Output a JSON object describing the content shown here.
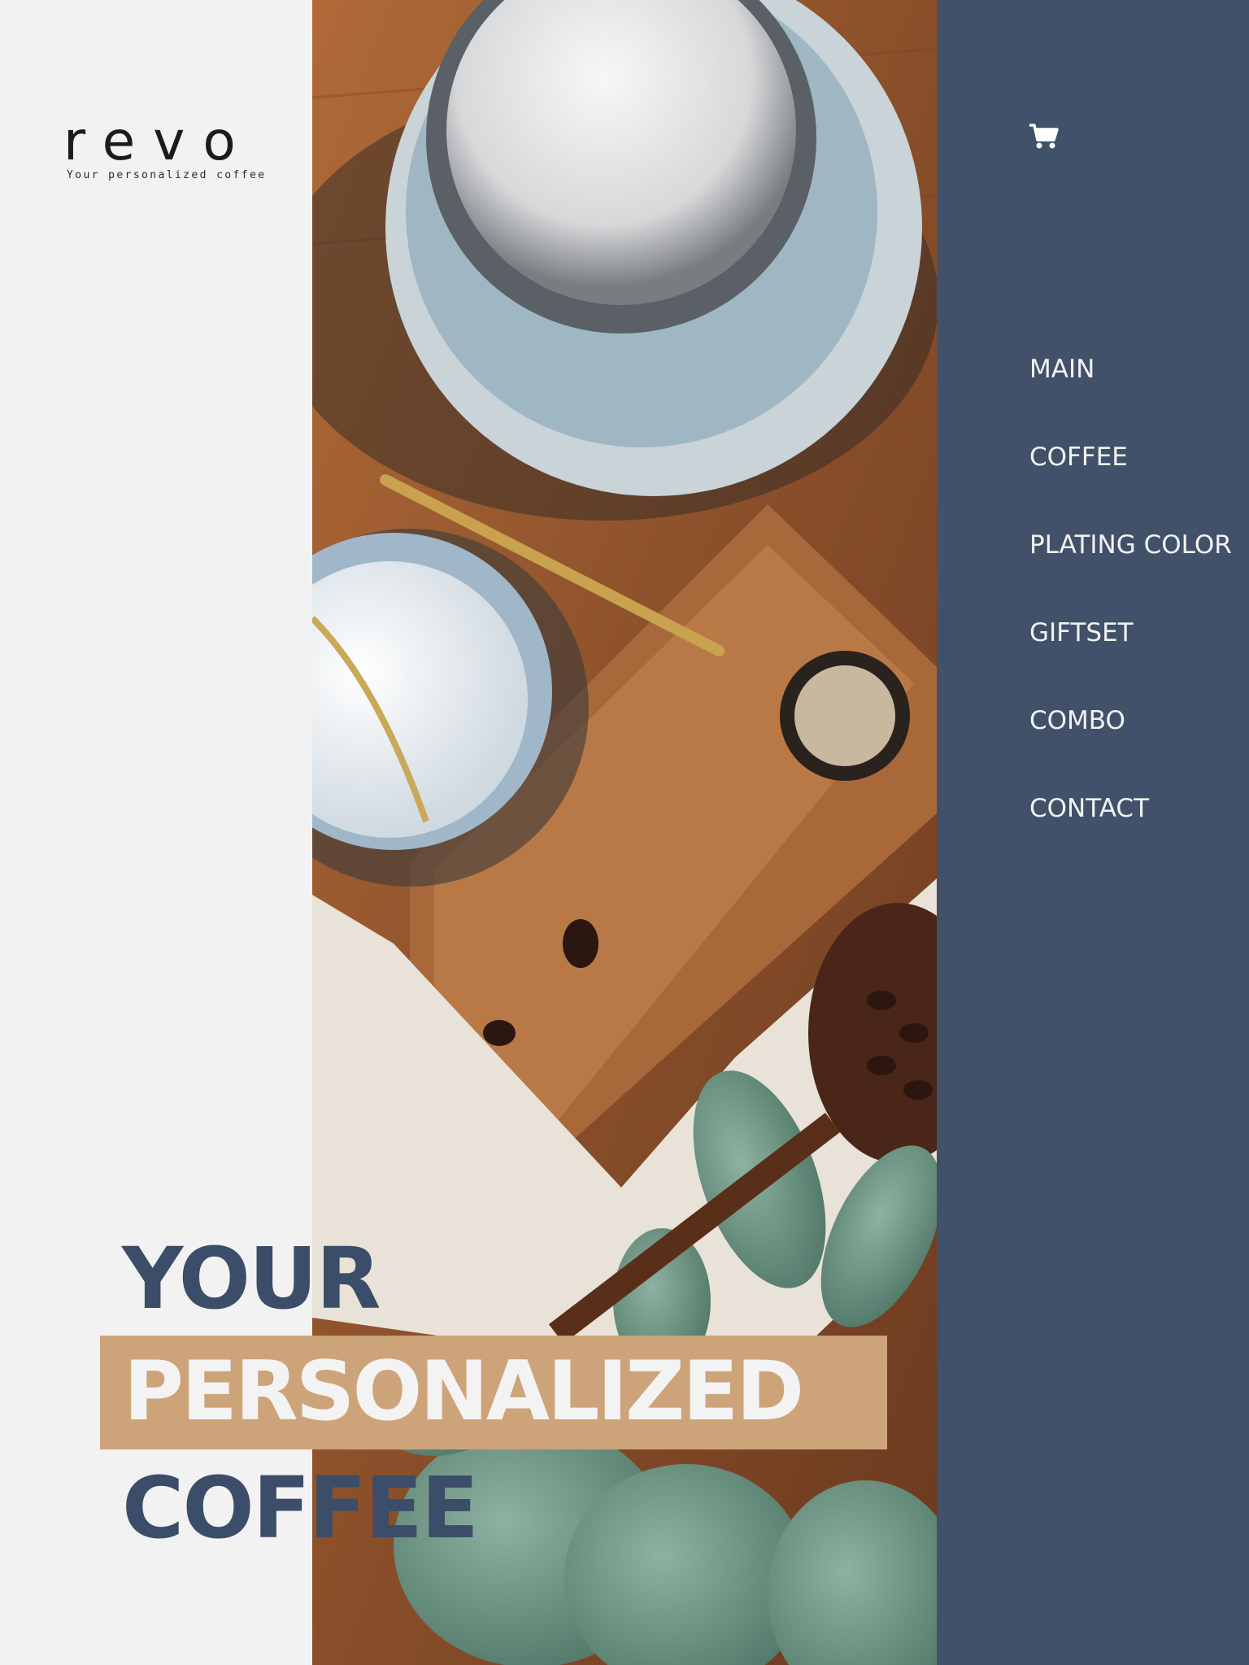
{
  "brand": {
    "logo_text": "revo",
    "tagline": "Your personalized coffee"
  },
  "colors": {
    "background": "#f2f2f2",
    "sidebar": "#405169",
    "accent": "#cda379",
    "headline": "#3b4d68",
    "nav_text": "#f1f1f1"
  },
  "header": {
    "cart_icon": "shopping-cart-icon"
  },
  "nav": {
    "items": [
      {
        "label": "MAIN"
      },
      {
        "label": "COFFEE"
      },
      {
        "label": "PLATING COLOR"
      },
      {
        "label": "GIFTSET"
      },
      {
        "label": "COMBO"
      },
      {
        "label": "CONTACT"
      }
    ]
  },
  "hero": {
    "line1": "YOUR",
    "line2": "PERSONALIZED",
    "line3": "COFFEE"
  }
}
